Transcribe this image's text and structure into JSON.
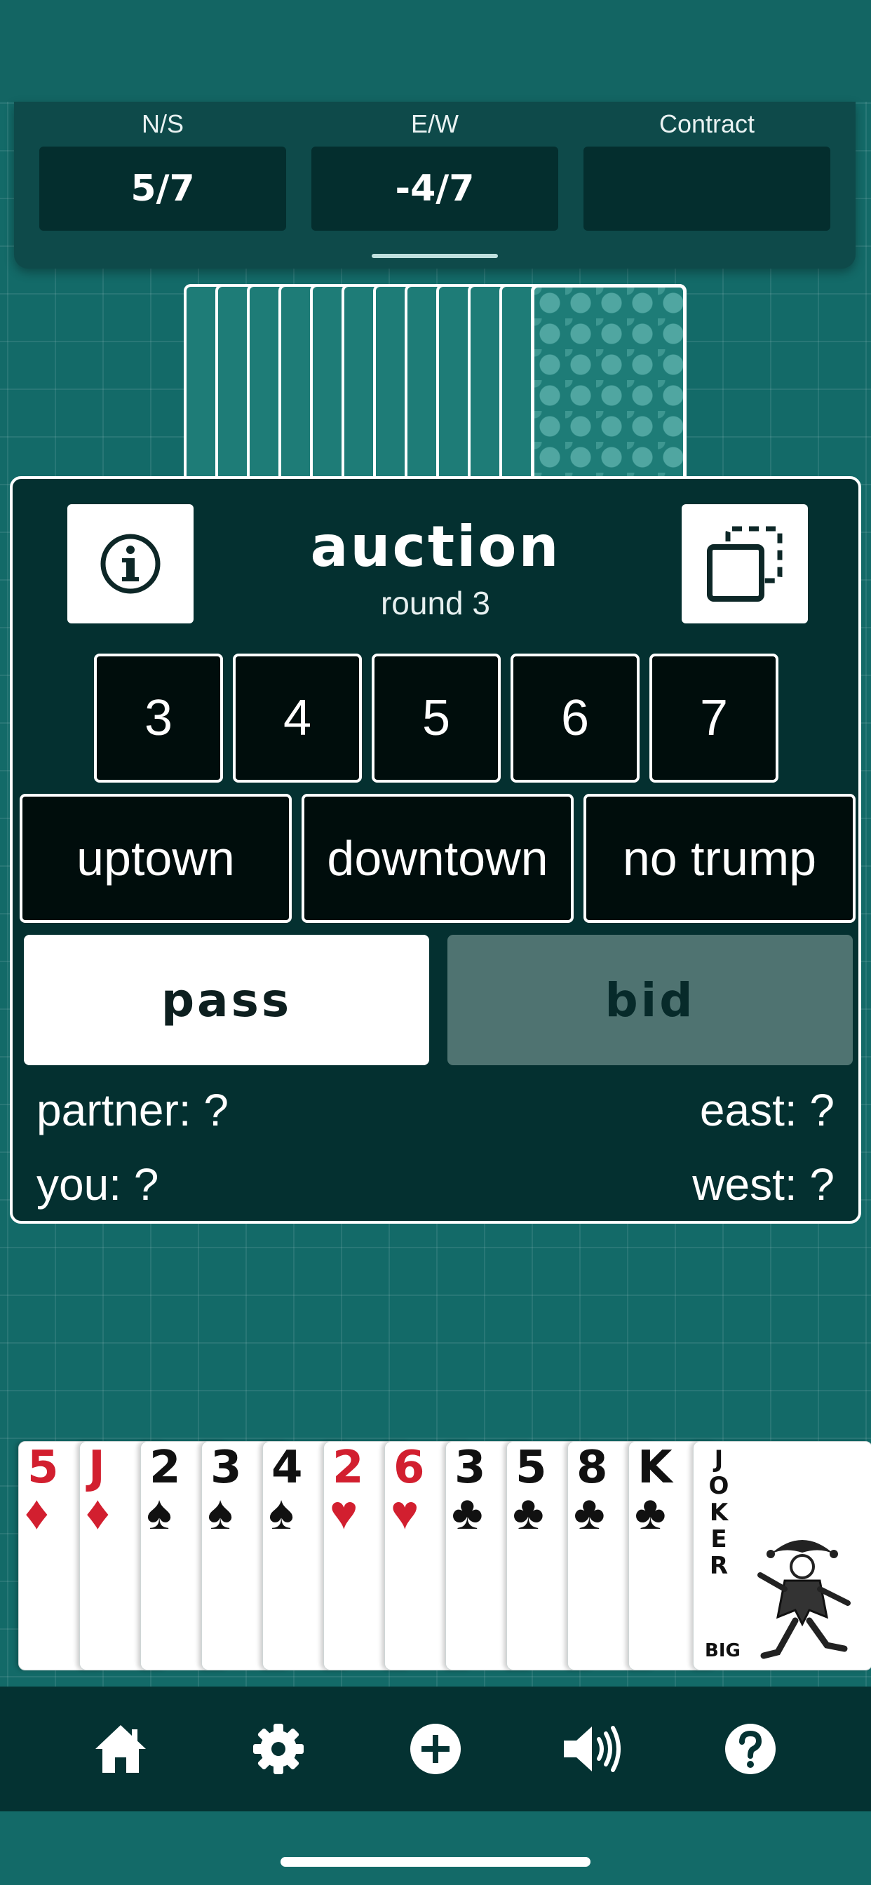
{
  "score": {
    "ns_label": "N/S",
    "ns_value": "5/7",
    "ew_label": "E/W",
    "ew_value": "-4/7",
    "contract_label": "Contract",
    "contract_value": ""
  },
  "opponent_hand": {
    "card_back_icon": "card-back-icon"
  },
  "auction": {
    "title": "auction",
    "round": "round 3",
    "info_icon": "info-icon",
    "copy_icon": "copy-icon",
    "bids": [
      "3",
      "4",
      "5",
      "6",
      "7"
    ],
    "trumps": [
      "uptown",
      "downtown",
      "no trump"
    ],
    "pass_label": "pass",
    "bid_label": "bid",
    "players": {
      "partner": "partner: ?",
      "east": "east: ?",
      "you": "you: ?",
      "west": "west: ?"
    }
  },
  "hand": {
    "cards": [
      {
        "rank": "5",
        "suit": "♦",
        "color": "#d21f2f"
      },
      {
        "rank": "J",
        "suit": "♦",
        "color": "#d21f2f"
      },
      {
        "rank": "2",
        "suit": "♠",
        "color": "#111111"
      },
      {
        "rank": "3",
        "suit": "♠",
        "color": "#111111"
      },
      {
        "rank": "4",
        "suit": "♠",
        "color": "#111111"
      },
      {
        "rank": "2",
        "suit": "♥",
        "color": "#d21f2f"
      },
      {
        "rank": "6",
        "suit": "♥",
        "color": "#d21f2f"
      },
      {
        "rank": "3",
        "suit": "♣",
        "color": "#111111"
      },
      {
        "rank": "5",
        "suit": "♣",
        "color": "#111111"
      },
      {
        "rank": "8",
        "suit": "♣",
        "color": "#111111"
      },
      {
        "rank": "K",
        "suit": "♣",
        "color": "#111111"
      }
    ],
    "joker": {
      "label": "JOKER",
      "size": "BIG"
    }
  },
  "nav": {
    "items": [
      "home-icon",
      "gear-icon",
      "plus-circle-icon",
      "speaker-icon",
      "help-icon"
    ]
  }
}
